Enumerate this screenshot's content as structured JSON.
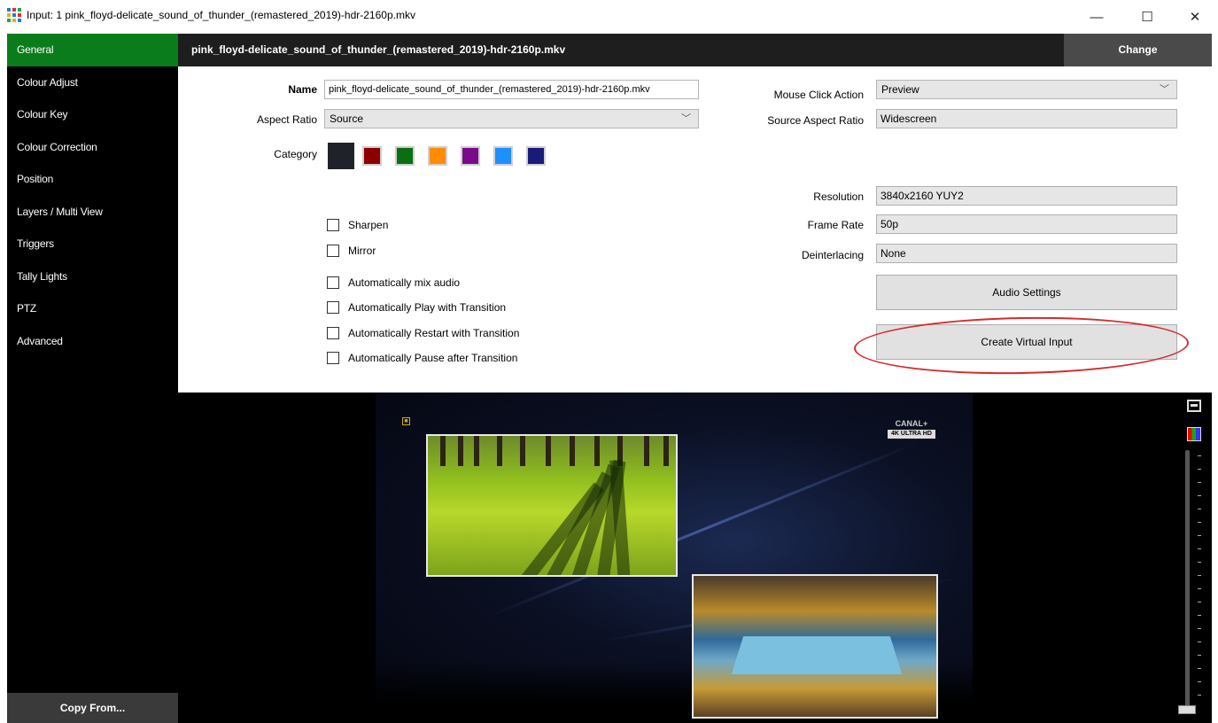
{
  "window": {
    "title": "Input: 1 pink_floyd-delicate_sound_of_thunder_(remastered_2019)-hdr-2160p.mkv",
    "minimize_glyph": "—",
    "maximize_glyph": "☐",
    "close_glyph": "✕"
  },
  "sidebar": {
    "items": [
      {
        "label": "General",
        "active": true
      },
      {
        "label": "Colour Adjust"
      },
      {
        "label": "Colour Key"
      },
      {
        "label": "Colour Correction"
      },
      {
        "label": "Position"
      },
      {
        "label": "Layers / Multi View"
      },
      {
        "label": "Triggers"
      },
      {
        "label": "Tally Lights"
      },
      {
        "label": "PTZ"
      },
      {
        "label": "Advanced"
      }
    ],
    "copy_from": "Copy From..."
  },
  "header": {
    "filename": "pink_floyd-delicate_sound_of_thunder_(remastered_2019)-hdr-2160p.mkv",
    "change_label": "Change"
  },
  "form": {
    "name_label": "Name",
    "name_value": "pink_floyd-delicate_sound_of_thunder_(remastered_2019)-hdr-2160p.mkv",
    "aspect_ratio_label": "Aspect Ratio",
    "aspect_ratio_value": "Source",
    "category_label": "Category",
    "categories": [
      "#1f2329",
      "#8b0000",
      "#0a6e12",
      "#ff8c00",
      "#7a0a8a",
      "#1e8fff",
      "#1a1a7a"
    ],
    "mouse_click_label": "Mouse Click Action",
    "mouse_click_value": "Preview",
    "source_aspect_label": "Source Aspect Ratio",
    "source_aspect_value": "Widescreen",
    "resolution_label": "Resolution",
    "resolution_value": "3840x2160 YUY2",
    "frame_rate_label": "Frame Rate",
    "frame_rate_value": "50p",
    "deinterlacing_label": "Deinterlacing",
    "deinterlacing_value": "None",
    "checkboxes": {
      "sharpen": "Sharpen",
      "mirror": "Mirror",
      "auto_mix_audio": "Automatically mix audio",
      "auto_play": "Automatically Play with Transition",
      "auto_restart": "Automatically Restart with Transition",
      "auto_pause": "Automatically Pause after Transition"
    },
    "audio_settings_label": "Audio Settings",
    "create_virtual_label": "Create Virtual Input"
  },
  "preview": {
    "channel_logo": "CANAL+",
    "channel_sub": "4K ULTRA HD"
  }
}
